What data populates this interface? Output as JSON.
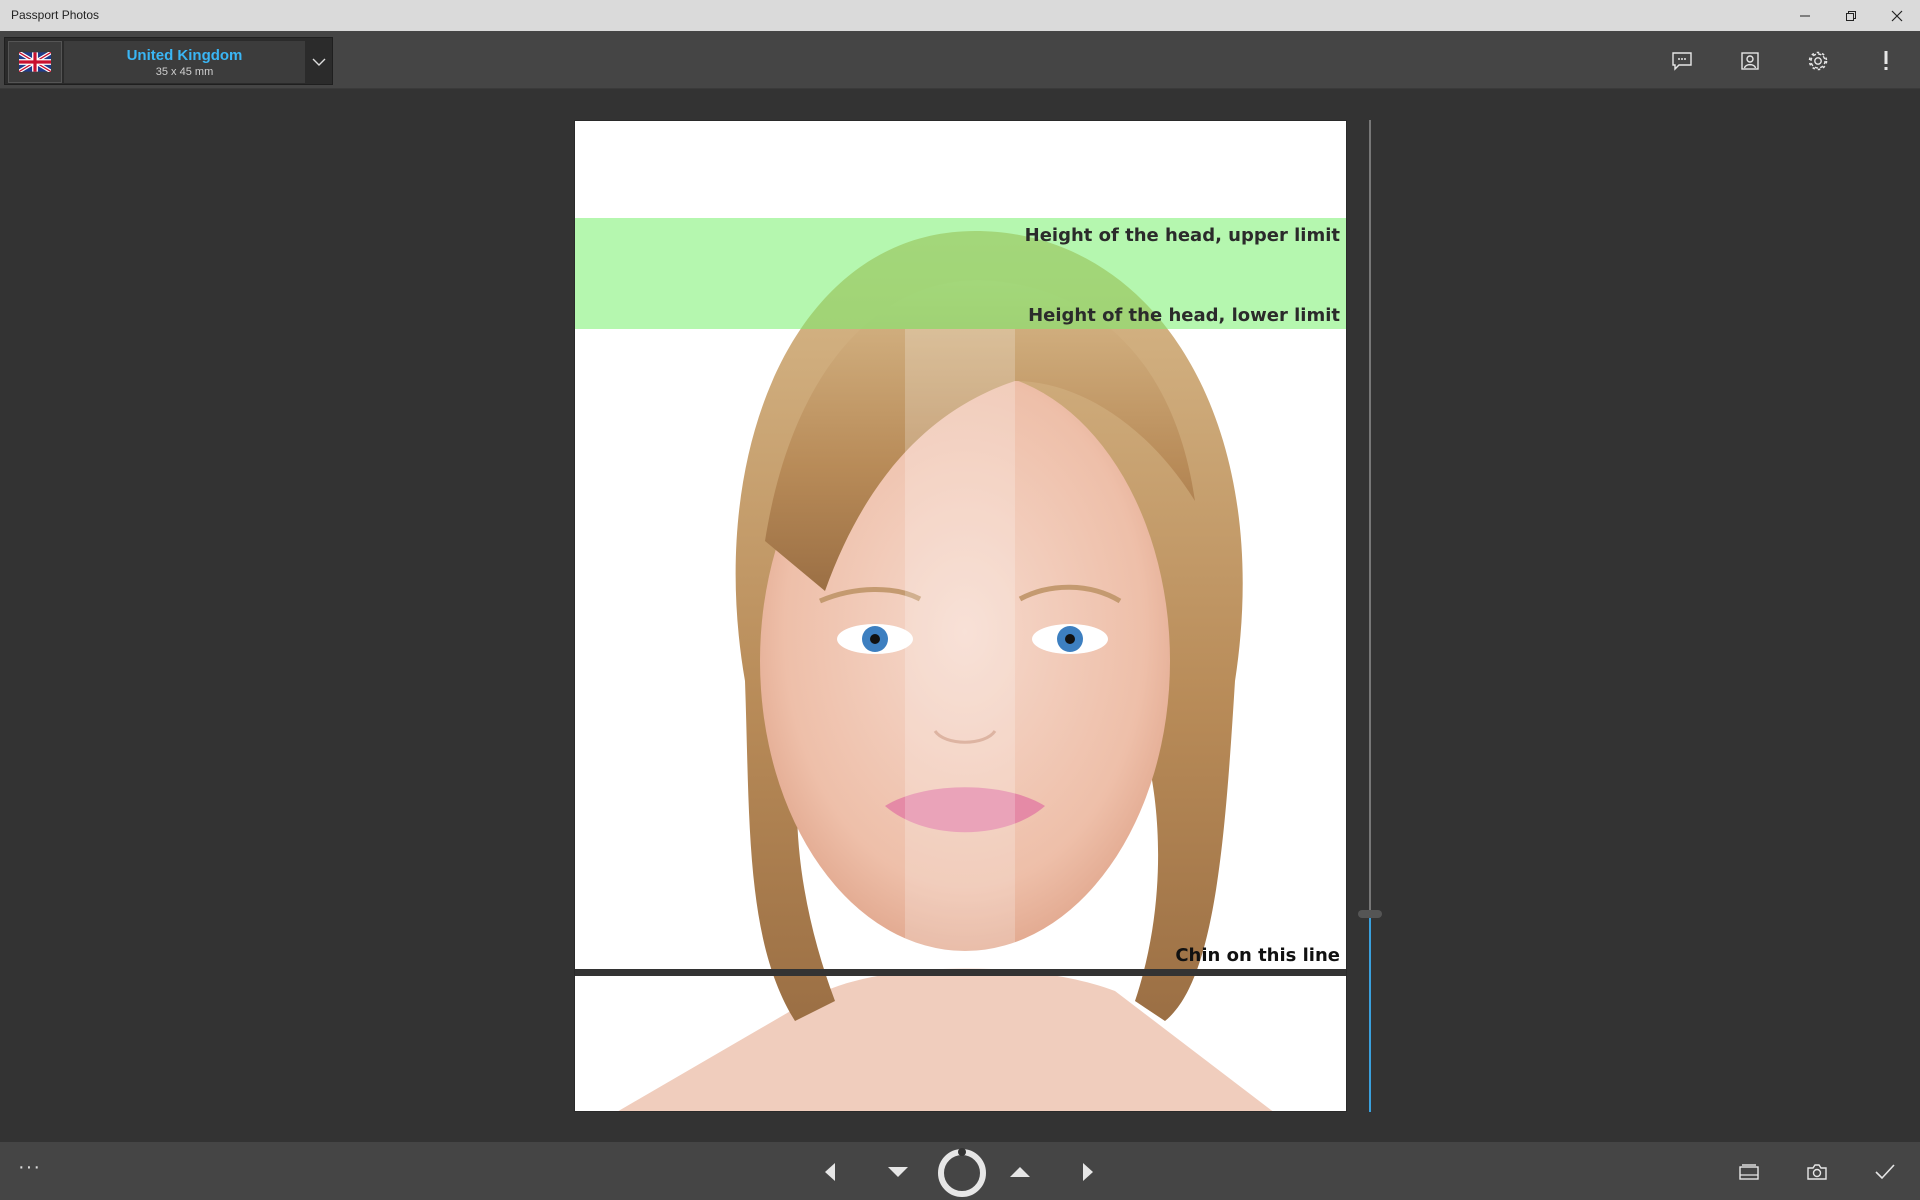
{
  "window": {
    "title": "Passport Photos",
    "controls": {
      "minimize": "minimize-icon",
      "restore": "restore-icon",
      "close": "close-icon"
    }
  },
  "country": {
    "name": "United Kingdom",
    "size": "35 x 45 mm",
    "flag_icon": "uk-flag-icon"
  },
  "toolbar": {
    "icons": [
      "feedback-icon",
      "portrait-icon",
      "gear-icon",
      "alert-icon"
    ]
  },
  "guides": {
    "head_upper": "Height of the head, upper limit",
    "head_lower": "Height of the head, lower limit",
    "chin": "Chin on this line"
  },
  "slider": {
    "value_fraction": 0.8
  },
  "bottombar": {
    "more": "···",
    "icons": [
      "arrow-left-icon",
      "arrow-down-icon",
      "rotate-icon",
      "arrow-up-icon",
      "arrow-right-icon",
      "gallery-icon",
      "camera-icon",
      "check-icon"
    ]
  },
  "colors": {
    "accent": "#3ab6f5",
    "head_zone": "#78f06e",
    "toolbar": "#454545",
    "background": "#333333"
  }
}
